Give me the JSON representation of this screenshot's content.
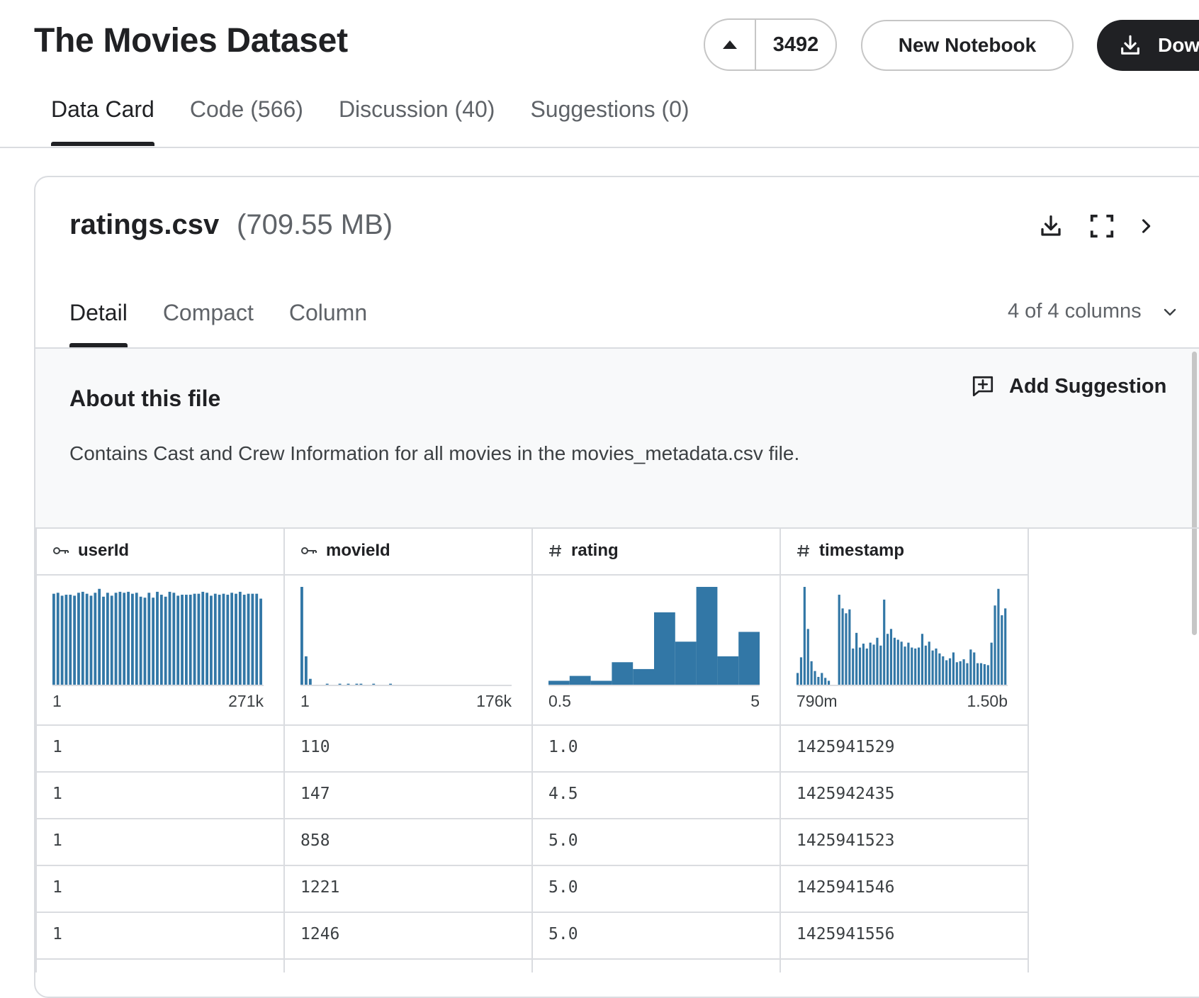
{
  "header": {
    "title": "The Movies Dataset",
    "vote_count": "3492",
    "new_notebook_label": "New Notebook",
    "download_label": "Dow"
  },
  "top_tabs": [
    {
      "label": "Data Card",
      "active": true
    },
    {
      "label": "Code (566)",
      "active": false
    },
    {
      "label": "Discussion (40)",
      "active": false
    },
    {
      "label": "Suggestions (0)",
      "active": false
    }
  ],
  "file": {
    "name": "ratings.csv",
    "size": "(709.55 MB)"
  },
  "view_tabs": [
    {
      "label": "Detail",
      "active": true
    },
    {
      "label": "Compact",
      "active": false
    },
    {
      "label": "Column",
      "active": false
    }
  ],
  "column_selector": "4 of 4 columns",
  "about": {
    "title": "About this file",
    "description": "Contains Cast and Crew Information for all movies in the movies_metadata.csv file.",
    "add_suggestion_label": "Add Suggestion"
  },
  "colors": {
    "bar": "#3277a6",
    "text": "#202124",
    "muted": "#5f6368",
    "border": "#dadce0"
  },
  "table": {
    "columns": [
      {
        "name": "userId",
        "icon": "key-icon",
        "range_min": "1",
        "range_max": "271k",
        "histogram": [
          0.93,
          0.94,
          0.91,
          0.92,
          0.92,
          0.91,
          0.94,
          0.95,
          0.93,
          0.91,
          0.94,
          0.98,
          0.9,
          0.94,
          0.91,
          0.94,
          0.95,
          0.94,
          0.95,
          0.93,
          0.94,
          0.9,
          0.89,
          0.94,
          0.89,
          0.95,
          0.92,
          0.9,
          0.95,
          0.94,
          0.91,
          0.92,
          0.92,
          0.92,
          0.93,
          0.93,
          0.95,
          0.94,
          0.91,
          0.93,
          0.92,
          0.93,
          0.92,
          0.94,
          0.93,
          0.95,
          0.92,
          0.93,
          0.93,
          0.93,
          0.88
        ]
      },
      {
        "name": "movieId",
        "icon": "key-icon",
        "range_min": "1",
        "range_max": "176k",
        "histogram": [
          1.0,
          0.29,
          0.06,
          0.0,
          0.0,
          0.0,
          0.01,
          0.0,
          0.0,
          0.01,
          0.0,
          0.01,
          0.0,
          0.01,
          0.01,
          0.0,
          0.0,
          0.01,
          0.0,
          0.0,
          0.0,
          0.01,
          0.0,
          0.0,
          0.0,
          0.0,
          0.0,
          0.0,
          0.0,
          0.0,
          0.0,
          0.0,
          0.0,
          0.0,
          0.0,
          0.0,
          0.0,
          0.0,
          0.0,
          0.0,
          0.0,
          0.0,
          0.0,
          0.0,
          0.0,
          0.0,
          0.0,
          0.0,
          0.0,
          0.0
        ]
      },
      {
        "name": "rating",
        "icon": "hash-icon",
        "range_min": "0.5",
        "range_max": "5",
        "histogram": [
          0.04,
          0.09,
          0.04,
          0.23,
          0.16,
          0.74,
          0.44,
          1.0,
          0.29,
          0.54
        ]
      },
      {
        "name": "timestamp",
        "icon": "hash-icon",
        "range_min": "790m",
        "range_max": "1.50b",
        "histogram": [
          0.12,
          0.28,
          1.0,
          0.57,
          0.24,
          0.14,
          0.08,
          0.12,
          0.07,
          0.04,
          0.0,
          0.0,
          0.92,
          0.78,
          0.73,
          0.77,
          0.37,
          0.53,
          0.38,
          0.42,
          0.37,
          0.43,
          0.41,
          0.48,
          0.4,
          0.87,
          0.52,
          0.57,
          0.48,
          0.46,
          0.44,
          0.39,
          0.43,
          0.38,
          0.37,
          0.38,
          0.52,
          0.4,
          0.44,
          0.35,
          0.37,
          0.32,
          0.29,
          0.25,
          0.27,
          0.33,
          0.23,
          0.24,
          0.26,
          0.22,
          0.36,
          0.33,
          0.22,
          0.22,
          0.21,
          0.2,
          0.43,
          0.81,
          0.98,
          0.71,
          0.78
        ]
      }
    ],
    "rows": [
      [
        "1",
        "110",
        "1.0",
        "1425941529"
      ],
      [
        "1",
        "147",
        "4.5",
        "1425942435"
      ],
      [
        "1",
        "858",
        "5.0",
        "1425941523"
      ],
      [
        "1",
        "1221",
        "5.0",
        "1425941546"
      ],
      [
        "1",
        "1246",
        "5.0",
        "1425941556"
      ]
    ]
  }
}
